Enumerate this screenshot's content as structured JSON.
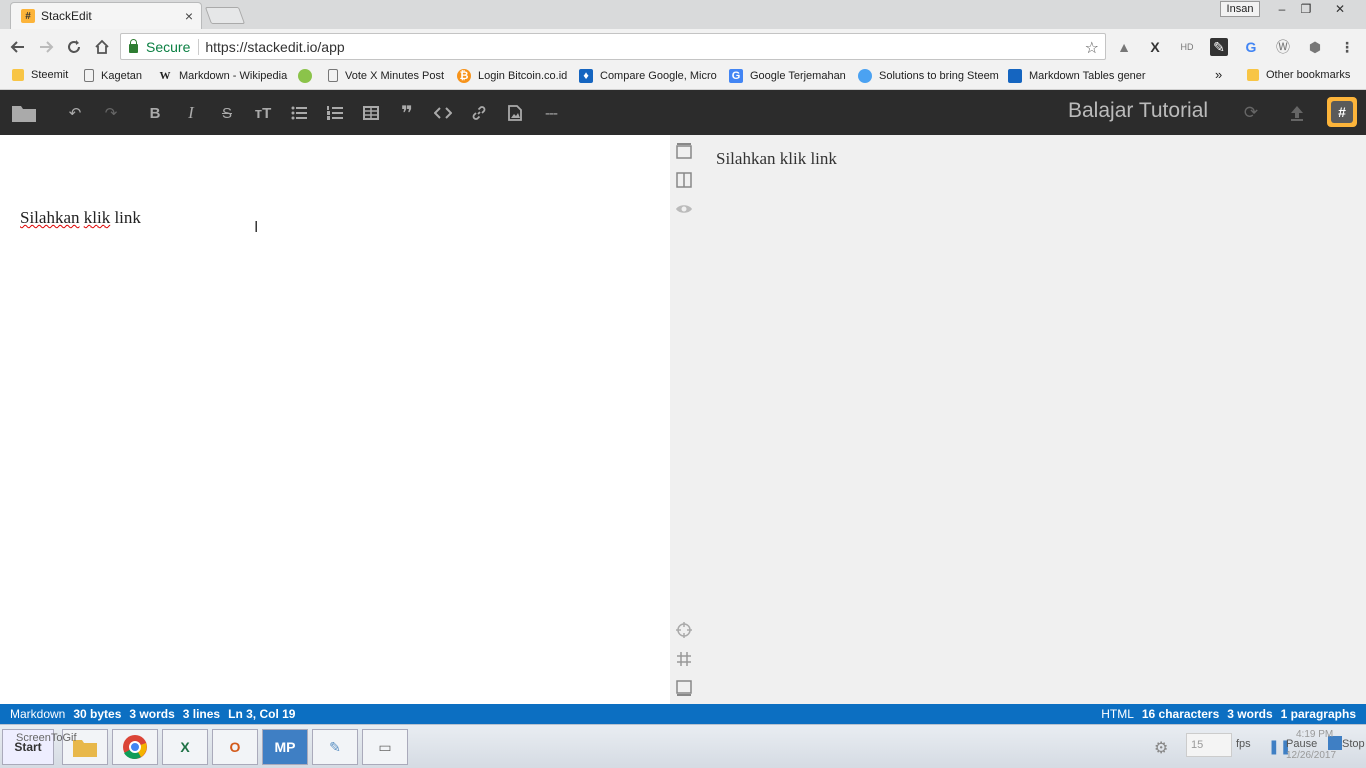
{
  "browser": {
    "tab_title": "StackEdit",
    "tab_close": "×",
    "profile": "Insan",
    "window_buttons": [
      "–",
      "❐",
      "✕"
    ],
    "secure_label": "Secure",
    "url": "https://stackedit.io/app"
  },
  "bookmarks": [
    {
      "label": "Steemit",
      "icon": "folder-icon",
      "color": "#f8c545"
    },
    {
      "label": "Kagetan",
      "icon": "page-icon",
      "color": "#ffffff"
    },
    {
      "label": "Markdown - Wikipedia",
      "icon": "wikipedia-icon",
      "color": "#ffffff"
    },
    {
      "label": "",
      "icon": "coin-icon",
      "color": "#8bc34a"
    },
    {
      "label": "Vote X Minutes Post",
      "icon": "page-icon",
      "color": "#ffffff"
    },
    {
      "label": "Login Bitcoin.co.id",
      "icon": "bitcoin-icon",
      "color": "#f7931a"
    },
    {
      "label": "Compare Google, Micro",
      "icon": "compare-icon",
      "color": "#1565c0"
    },
    {
      "label": "Google Terjemahan",
      "icon": "translate-icon",
      "color": "#4285f4"
    },
    {
      "label": "Solutions to bring Steem",
      "icon": "steem-icon",
      "color": "#4ba2f2"
    },
    {
      "label": "Markdown Tables gener",
      "icon": "table-icon",
      "color": "#1565c0"
    }
  ],
  "bookmarks_overflow": "»",
  "other_bookmarks": "Other bookmarks",
  "editor": {
    "doc_title": "Balajar Tutorial",
    "content_word1": "Silahkan",
    "content_word2": "klik",
    "content_word3": "link",
    "preview_text": "Silahkan klik link"
  },
  "status_left": {
    "mode": "Markdown",
    "bytes": "30 bytes",
    "words": "3 words",
    "lines": "3 lines",
    "position": "Ln 3, Col 19"
  },
  "status_right": {
    "mode": "HTML",
    "characters": "16 characters",
    "words": "3 words",
    "paragraphs": "1 paragraphs"
  },
  "taskbar": {
    "start": "Start",
    "screentogif": "ScreenToGif",
    "fps_value": "15",
    "fps_label": "fps",
    "pause": "Pause",
    "stop": "Stop",
    "time": "4:19 PM",
    "date": "12/26/2017",
    "mp_label": "MP"
  },
  "colors": {
    "nav_bg": "#2c2c2c",
    "status_bg": "#0c6fc2",
    "logo": "#fcb43a"
  }
}
